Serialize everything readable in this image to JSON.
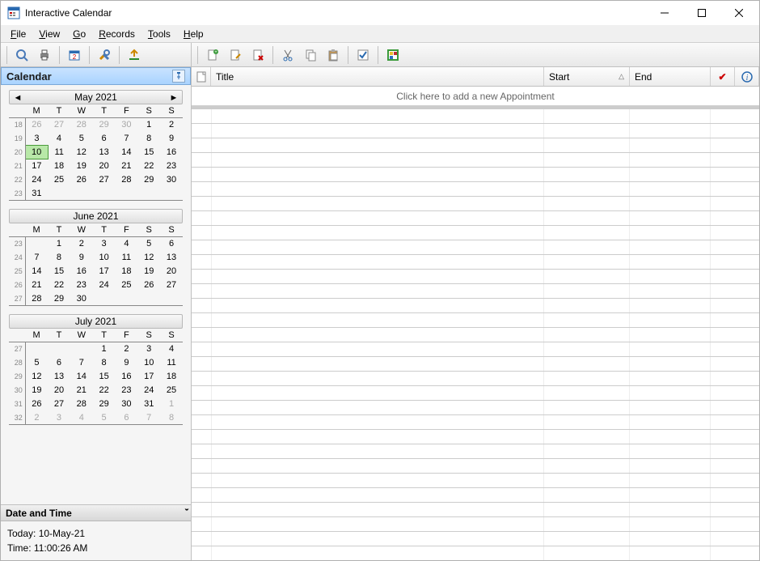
{
  "window": {
    "title": "Interactive Calendar"
  },
  "menu": {
    "file": "File",
    "view": "View",
    "go": "Go",
    "records": "Records",
    "tools": "Tools",
    "help": "Help"
  },
  "sidebar": {
    "header": "Calendar"
  },
  "months": [
    {
      "title": "May 2021",
      "show_nav": true,
      "dow": [
        "M",
        "T",
        "W",
        "T",
        "F",
        "S",
        "S"
      ],
      "weeks": [
        {
          "wk": "18",
          "days": [
            {
              "d": "26",
              "dim": true
            },
            {
              "d": "27",
              "dim": true
            },
            {
              "d": "28",
              "dim": true
            },
            {
              "d": "29",
              "dim": true
            },
            {
              "d": "30",
              "dim": true
            },
            {
              "d": "1"
            },
            {
              "d": "2"
            }
          ]
        },
        {
          "wk": "19",
          "days": [
            {
              "d": "3"
            },
            {
              "d": "4"
            },
            {
              "d": "5"
            },
            {
              "d": "6"
            },
            {
              "d": "7"
            },
            {
              "d": "8"
            },
            {
              "d": "9"
            }
          ]
        },
        {
          "wk": "20",
          "days": [
            {
              "d": "10",
              "today": true
            },
            {
              "d": "11"
            },
            {
              "d": "12"
            },
            {
              "d": "13"
            },
            {
              "d": "14"
            },
            {
              "d": "15"
            },
            {
              "d": "16"
            }
          ]
        },
        {
          "wk": "21",
          "days": [
            {
              "d": "17"
            },
            {
              "d": "18"
            },
            {
              "d": "19"
            },
            {
              "d": "20"
            },
            {
              "d": "21"
            },
            {
              "d": "22"
            },
            {
              "d": "23"
            }
          ]
        },
        {
          "wk": "22",
          "days": [
            {
              "d": "24"
            },
            {
              "d": "25"
            },
            {
              "d": "26"
            },
            {
              "d": "27"
            },
            {
              "d": "28"
            },
            {
              "d": "29"
            },
            {
              "d": "30"
            }
          ]
        },
        {
          "wk": "23",
          "days": [
            {
              "d": "31"
            },
            {
              "d": ""
            },
            {
              "d": ""
            },
            {
              "d": ""
            },
            {
              "d": ""
            },
            {
              "d": ""
            },
            {
              "d": ""
            }
          ]
        }
      ]
    },
    {
      "title": "June 2021",
      "show_nav": false,
      "dow": [
        "M",
        "T",
        "W",
        "T",
        "F",
        "S",
        "S"
      ],
      "weeks": [
        {
          "wk": "23",
          "days": [
            {
              "d": ""
            },
            {
              "d": "1"
            },
            {
              "d": "2"
            },
            {
              "d": "3"
            },
            {
              "d": "4"
            },
            {
              "d": "5"
            },
            {
              "d": "6"
            }
          ]
        },
        {
          "wk": "24",
          "days": [
            {
              "d": "7"
            },
            {
              "d": "8"
            },
            {
              "d": "9"
            },
            {
              "d": "10"
            },
            {
              "d": "11"
            },
            {
              "d": "12"
            },
            {
              "d": "13"
            }
          ]
        },
        {
          "wk": "25",
          "days": [
            {
              "d": "14"
            },
            {
              "d": "15"
            },
            {
              "d": "16"
            },
            {
              "d": "17"
            },
            {
              "d": "18"
            },
            {
              "d": "19"
            },
            {
              "d": "20"
            }
          ]
        },
        {
          "wk": "26",
          "days": [
            {
              "d": "21"
            },
            {
              "d": "22"
            },
            {
              "d": "23"
            },
            {
              "d": "24"
            },
            {
              "d": "25"
            },
            {
              "d": "26"
            },
            {
              "d": "27"
            }
          ]
        },
        {
          "wk": "27",
          "days": [
            {
              "d": "28"
            },
            {
              "d": "29"
            },
            {
              "d": "30"
            },
            {
              "d": ""
            },
            {
              "d": ""
            },
            {
              "d": ""
            },
            {
              "d": ""
            }
          ]
        }
      ]
    },
    {
      "title": "July 2021",
      "show_nav": false,
      "dow": [
        "M",
        "T",
        "W",
        "T",
        "F",
        "S",
        "S"
      ],
      "weeks": [
        {
          "wk": "27",
          "days": [
            {
              "d": ""
            },
            {
              "d": ""
            },
            {
              "d": ""
            },
            {
              "d": "1"
            },
            {
              "d": "2"
            },
            {
              "d": "3"
            },
            {
              "d": "4"
            }
          ]
        },
        {
          "wk": "28",
          "days": [
            {
              "d": "5"
            },
            {
              "d": "6"
            },
            {
              "d": "7"
            },
            {
              "d": "8"
            },
            {
              "d": "9"
            },
            {
              "d": "10"
            },
            {
              "d": "11"
            }
          ]
        },
        {
          "wk": "29",
          "days": [
            {
              "d": "12"
            },
            {
              "d": "13"
            },
            {
              "d": "14"
            },
            {
              "d": "15"
            },
            {
              "d": "16"
            },
            {
              "d": "17"
            },
            {
              "d": "18"
            }
          ]
        },
        {
          "wk": "30",
          "days": [
            {
              "d": "19"
            },
            {
              "d": "20"
            },
            {
              "d": "21"
            },
            {
              "d": "22"
            },
            {
              "d": "23"
            },
            {
              "d": "24"
            },
            {
              "d": "25"
            }
          ]
        },
        {
          "wk": "31",
          "days": [
            {
              "d": "26"
            },
            {
              "d": "27"
            },
            {
              "d": "28"
            },
            {
              "d": "29"
            },
            {
              "d": "30"
            },
            {
              "d": "31"
            },
            {
              "d": "1",
              "dim": true
            }
          ]
        },
        {
          "wk": "32",
          "days": [
            {
              "d": "2",
              "dim": true
            },
            {
              "d": "3",
              "dim": true
            },
            {
              "d": "4",
              "dim": true
            },
            {
              "d": "5",
              "dim": true
            },
            {
              "d": "6",
              "dim": true
            },
            {
              "d": "7",
              "dim": true
            },
            {
              "d": "8",
              "dim": true
            }
          ]
        }
      ]
    }
  ],
  "datetime": {
    "header": "Date and Time",
    "today_label": "Today:",
    "today_value": "10-May-21",
    "time_label": "Time:",
    "time_value": "11:00:26 AM"
  },
  "list": {
    "cols": {
      "title": "Title",
      "start": "Start",
      "end": "End"
    },
    "add_prompt": "Click here to add a new Appointment"
  }
}
